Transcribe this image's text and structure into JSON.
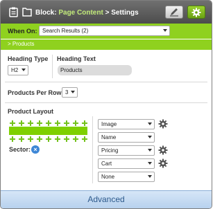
{
  "header": {
    "block_label": "Block:",
    "block_link": "Page Content",
    "separator": ">",
    "current": "Settings"
  },
  "when_on": {
    "label": "When On:",
    "selected": "Search Results (2)"
  },
  "section": {
    "title": "> Products"
  },
  "heading": {
    "type_label": "Heading Type",
    "type_value": "H2",
    "text_label": "Heading Text",
    "text_value": "Products"
  },
  "per_row": {
    "label": "Products Per Row",
    "value": "3"
  },
  "layout": {
    "label": "Product Layout",
    "sector_label": "Sector:",
    "sector_remove": "×",
    "slots": [
      {
        "value": "Image",
        "has_gear": true
      },
      {
        "value": "Name",
        "has_gear": false
      },
      {
        "value": "Pricing",
        "has_gear": true
      },
      {
        "value": "Cart",
        "has_gear": true
      },
      {
        "value": "None",
        "has_gear": false
      }
    ]
  },
  "footer": {
    "advanced_label": "Advanced"
  },
  "colors": {
    "accent_green": "#8fd11f",
    "title_bar": "#4c4c4c",
    "footer_blue": "#b7d1ee"
  }
}
